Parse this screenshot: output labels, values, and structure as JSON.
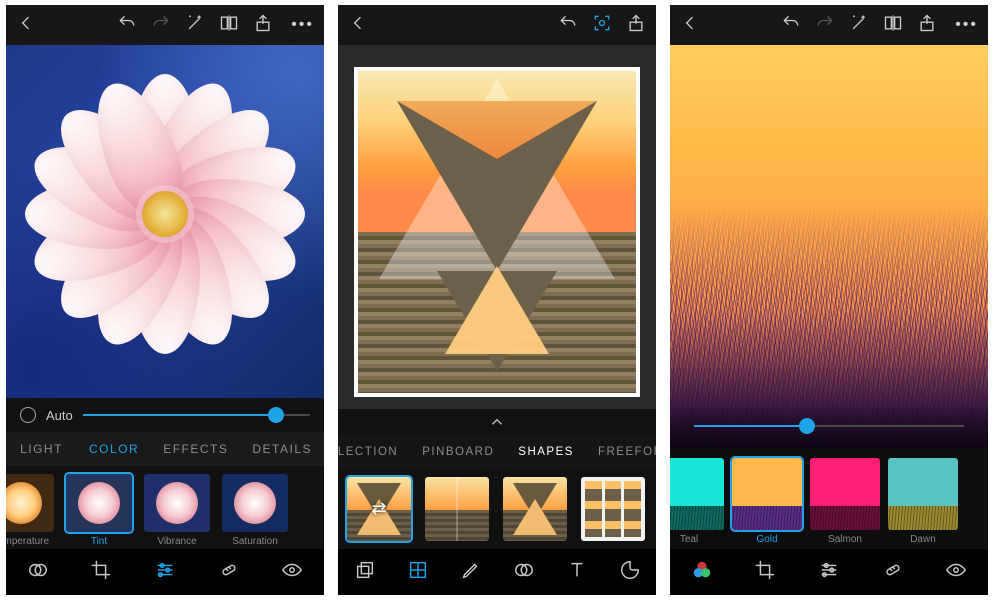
{
  "accent": "#1ea3e6",
  "panel1": {
    "slider": {
      "auto_label": "Auto",
      "percent": 85
    },
    "tabs": {
      "light": "LIGHT",
      "color": "COLOR",
      "effects": "EFFECTS",
      "details": "DETAILS",
      "selected": "color"
    },
    "presets": {
      "items": [
        {
          "label": "Temperature",
          "variant": "warm"
        },
        {
          "label": "Tint",
          "variant": "default",
          "selected": true
        },
        {
          "label": "Vibrance",
          "variant": "vib"
        },
        {
          "label": "Saturation",
          "variant": "sat"
        }
      ]
    },
    "bottom_selected": "sliders"
  },
  "panel2": {
    "tabs": {
      "reflection": "REFLECTION",
      "pinboard": "PINBOARD",
      "shapes": "SHAPES",
      "freeforms": "FREEFORMS",
      "selected": "shapes"
    },
    "presets": {
      "items": [
        {
          "variant": "shuffle",
          "selected": true
        },
        {
          "variant": "mirror"
        },
        {
          "variant": "hourglass"
        },
        {
          "variant": "strips"
        }
      ]
    },
    "bottom_selected": "collage"
  },
  "panel3": {
    "slider": {
      "percent": 42
    },
    "presets": {
      "items": [
        {
          "label": "Teal",
          "bg": "#18e6d8",
          "grass": "#0e6a63"
        },
        {
          "label": "Gold",
          "bg": "#ffb94a",
          "grass": "#5a2e86",
          "selected": true
        },
        {
          "label": "Salmon",
          "bg": "#ff1f78",
          "grass": "#6a0f3a"
        },
        {
          "label": "Dawn",
          "bg": "#58c3c5",
          "grass": "#9a8a30"
        }
      ]
    },
    "bottom_selected": "overlap"
  }
}
